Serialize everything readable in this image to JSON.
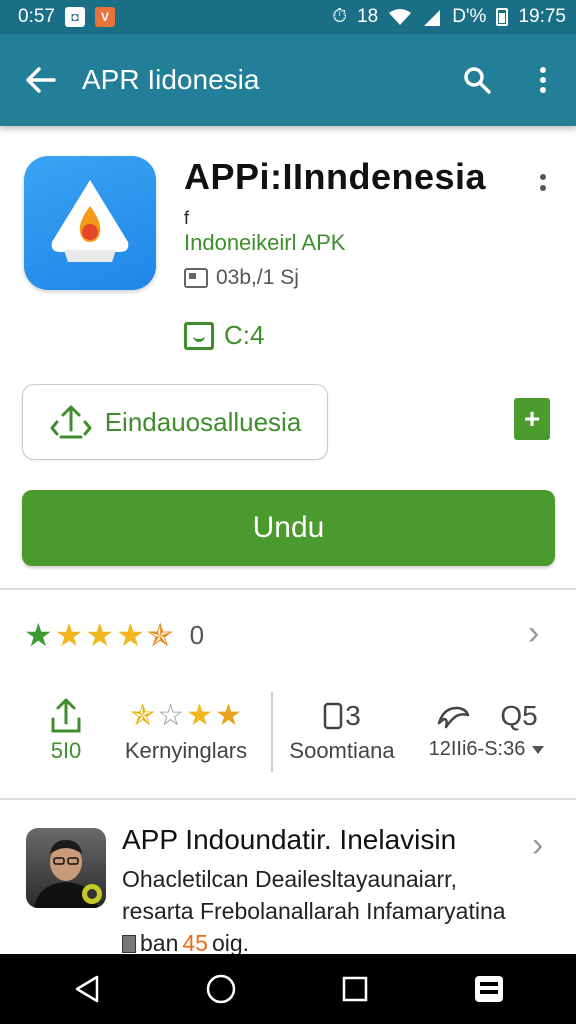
{
  "status_bar": {
    "time_left": "0:57",
    "alarm_text": "18",
    "signal_text": "D'%",
    "time_right": "19:75"
  },
  "app_bar": {
    "title": "APR Iidonesia",
    "back_icon": "arrow-left-icon",
    "search_icon": "search-icon",
    "menu_icon": "more-vert-icon"
  },
  "app": {
    "title": "APPi:IInndenesia",
    "meta_small": "f",
    "developer": "Indoneikeirl APK",
    "size_text": "03b,/1 Sj",
    "rating_value": "C:4",
    "icon_color": "#2a95ee"
  },
  "buttons": {
    "share_label": "Eindauosalluesia",
    "add_label": "+",
    "install_label": "Undu"
  },
  "rating_summary": {
    "count": "0",
    "stars": [
      {
        "color": "#3e9a33"
      },
      {
        "color": "#f2b61e"
      },
      {
        "color": "#f2b61e"
      },
      {
        "color": "#f2b61e"
      },
      {
        "color": "#e88a1e"
      }
    ]
  },
  "stats": [
    {
      "top": "",
      "label": "5I0"
    },
    {
      "top": "",
      "label": "Kernyinglars"
    },
    {
      "top": "3",
      "label": "Soomtiana"
    },
    {
      "top": "Q5",
      "label": "12IIi6-S:36"
    }
  ],
  "review": {
    "title": "APP Indoundatir. Inelavisin",
    "line1": "Ohacletilcan Deailesltayaunaiarr,",
    "line2": "resarta Frebolanallarah Infamaryatina",
    "line3_prefix": "ban",
    "line3_highlight": "45",
    "line3_suffix": "oig."
  },
  "colors": {
    "app_bar": "#237e97",
    "status_bar": "#1a6f86",
    "install_green": "#4b9a2e",
    "accent_green": "#3e8e2c"
  }
}
